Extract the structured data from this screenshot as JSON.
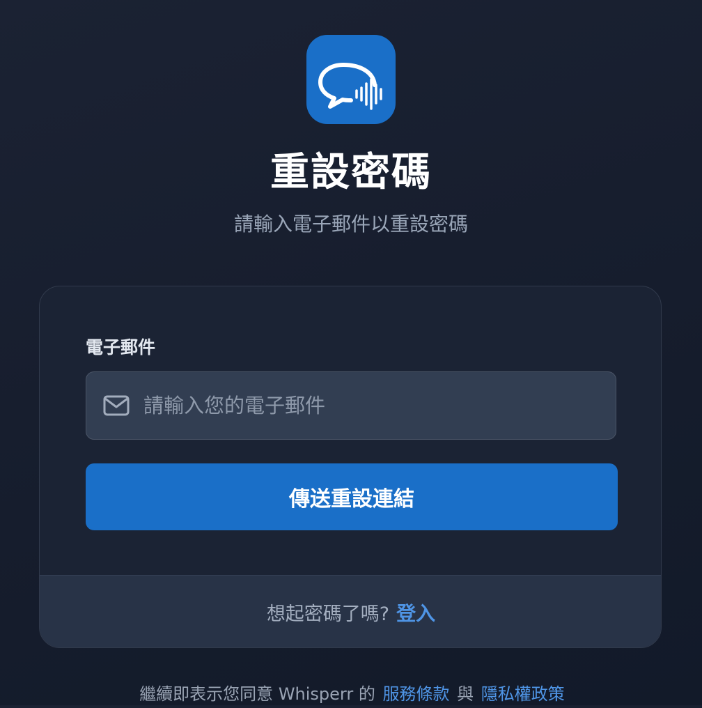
{
  "brand": {
    "logo_icon": "chat-bubble-soundwave-icon",
    "accent_color": "#1a6fc8"
  },
  "header": {
    "title": "重設密碼",
    "subtitle": "請輸入電子郵件以重設密碼"
  },
  "form": {
    "email_label": "電子郵件",
    "email_placeholder": "請輸入您的電子郵件",
    "email_value": "",
    "email_icon": "mail-icon",
    "submit_label": "傳送重設連結"
  },
  "footer": {
    "prompt": "想起密碼了嗎?",
    "login_link": "登入"
  },
  "legal": {
    "prefix": "繼續即表示您同意 Whisperr 的",
    "terms_link": "服務條款",
    "conjunction": "與",
    "privacy_link": "隱私權政策"
  }
}
